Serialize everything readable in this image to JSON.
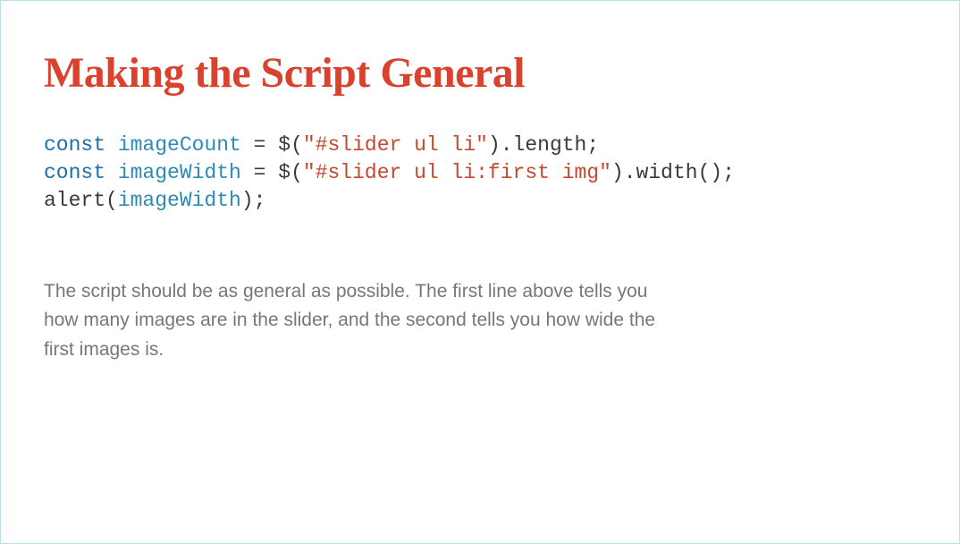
{
  "title": "Making the Script General",
  "code": {
    "line1": {
      "kw": "const",
      "var": "imageCount",
      "eq": " = ",
      "dollar": "$(",
      "str": "\"#slider ul li\"",
      "close": ").",
      "prop": "length",
      "semi": ";"
    },
    "line2": {
      "kw": "const",
      "var": "imageWidth",
      "eq": " = ",
      "dollar": "$(",
      "str": "\"#slider ul li:first img\"",
      "close": ").",
      "fn": "width",
      "paren": "()",
      "semi": ";"
    },
    "line3": {
      "fn": "alert",
      "open": "(",
      "arg": "imageWidth",
      "close": ")",
      "semi": ";"
    }
  },
  "body": "The script should be as general as possible. The first line above tells you how many images are in the slider, and the second tells you how wide the first images is."
}
